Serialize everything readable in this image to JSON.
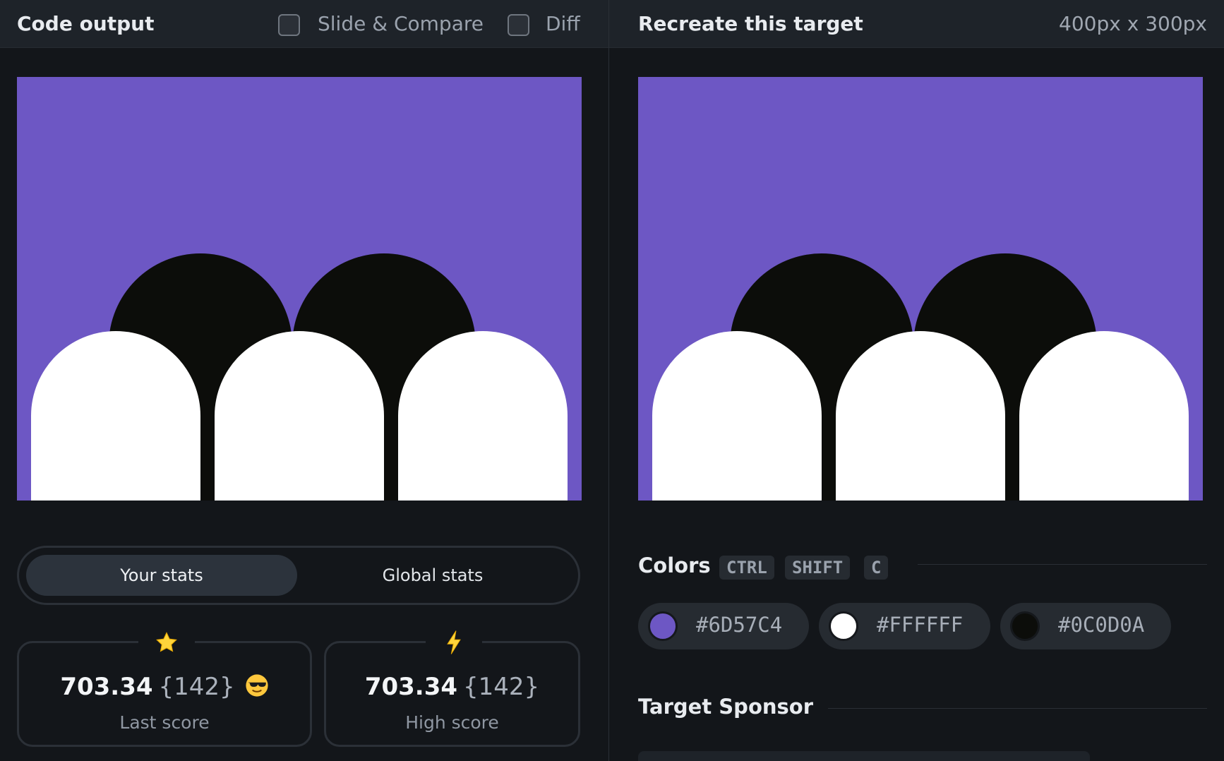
{
  "left_header": {
    "title": "Code output",
    "slide_compare_label": "Slide & Compare",
    "diff_label": "Diff"
  },
  "right_header": {
    "title": "Recreate this target",
    "size": "400px x 300px"
  },
  "stats": {
    "tab_your": "Your stats",
    "tab_global": "Global stats",
    "active_tab": "Your stats",
    "last_score": {
      "icon": "star-icon",
      "value": "703.34",
      "count": "{142}",
      "emoji": "sunglasses-face-icon",
      "label": "Last score"
    },
    "high_score": {
      "icon": "lightning-icon",
      "value": "703.34",
      "count": "{142}",
      "label": "High score"
    }
  },
  "colors": {
    "heading": "Colors",
    "shortcut_keys": [
      "CTRL",
      "SHIFT",
      "C"
    ],
    "swatches": [
      {
        "code": "#6D57C4",
        "color": "#6D57C4"
      },
      {
        "code": "#FFFFFF",
        "color": "#FFFFFF"
      },
      {
        "code": "#0C0D0A",
        "color": "#0C0D0A"
      }
    ]
  },
  "sponsor": {
    "heading": "Target Sponsor"
  },
  "palette": {
    "background": "#6D57C4",
    "arch": "#FFFFFF",
    "shadow": "#0C0D0A"
  }
}
